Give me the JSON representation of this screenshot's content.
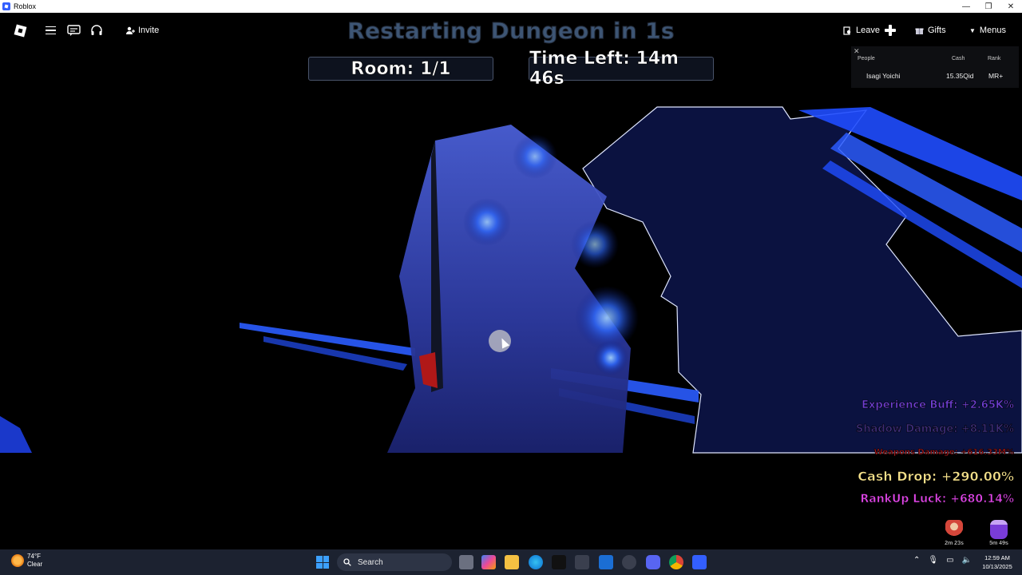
{
  "window": {
    "title": "Roblox",
    "controls": [
      "—",
      "❐",
      "✕"
    ]
  },
  "roblox_topbar": {
    "invite_label": "Invite",
    "leave_label": "Leave",
    "gifts_label": "Gifts",
    "menus_label": "Menus"
  },
  "dungeon_hud": {
    "restart_text": "Restarting Dungeon in 1s",
    "room_text": "Room: 1/1",
    "time_left_text": "Time Left: 14m 46s"
  },
  "leaderboard": {
    "close": "✕",
    "columns": {
      "people": "People",
      "cash": "Cash",
      "rank": "Rank"
    },
    "rows": [
      {
        "name": "Isagi Yoichi",
        "cash": "15.35Qid",
        "rank": "MR+"
      }
    ]
  },
  "buffs": {
    "experience": "Experience Buff: +2.65K%",
    "shadow": "Shadow Damage: +8.11K%",
    "weapons": "Weapons Damage: +616.33M%",
    "cash_drop": "Cash Drop: +290.00%",
    "rankup_luck": "RankUp Luck: +680.14%",
    "colors": {
      "experience": "#6f3fd4",
      "cash_drop": "#f4e08a",
      "rankup_luck": "#e045e8",
      "weapons": "#b0181a"
    }
  },
  "timers": [
    {
      "icon": "character-icon",
      "label": "2m 23s"
    },
    {
      "icon": "potion-icon",
      "label": "5m 49s"
    }
  ],
  "taskbar": {
    "weather_temp": "74°F",
    "weather_desc": "Clear",
    "search_placeholder": "Search",
    "time": "12:59 AM",
    "date": "10/13/2025"
  }
}
